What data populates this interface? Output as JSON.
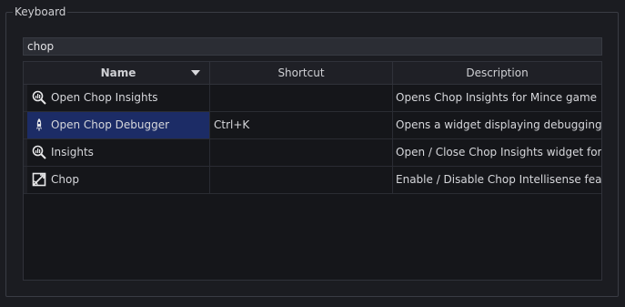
{
  "group": {
    "title": "Keyboard"
  },
  "search": {
    "value": "chop"
  },
  "table": {
    "columns": [
      "Name",
      "Shortcut",
      "Description"
    ],
    "rows": [
      {
        "icon": "insights-icon",
        "name": "Open Chop Insights",
        "shortcut": "",
        "description": "Opens Chop Insights for Mince game ...",
        "selected": false
      },
      {
        "icon": "debugger-icon",
        "name": "Open Chop Debugger",
        "shortcut": "Ctrl+K",
        "description": "Opens a widget displaying debugging inf...",
        "selected": true
      },
      {
        "icon": "insights-icon",
        "name": "Insights",
        "shortcut": "",
        "description": "Open / Close Chop Insights widget for Min...",
        "selected": false
      },
      {
        "icon": "intellisense-icon",
        "name": "Chop",
        "shortcut": "",
        "description": "Enable / Disable Chop Intellisense feature...",
        "selected": false
      }
    ]
  },
  "colors": {
    "selection": "#1c2c66",
    "background": "#1b1c21",
    "table_bg": "#15161a"
  }
}
